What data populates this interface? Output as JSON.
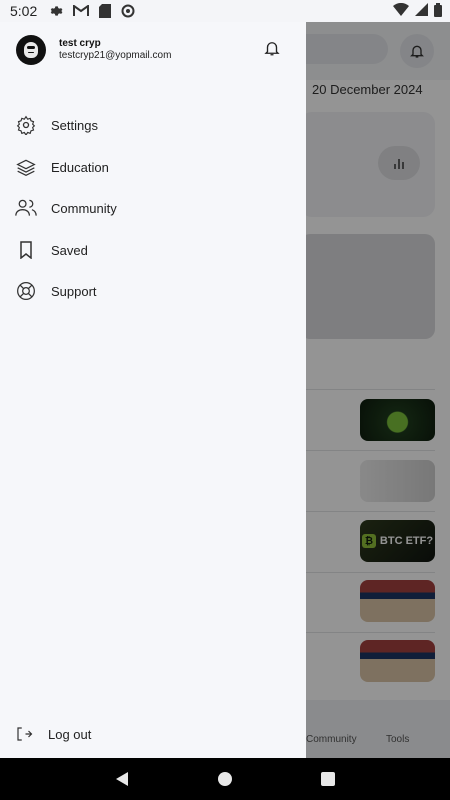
{
  "status_bar": {
    "time": "5:02"
  },
  "drawer": {
    "user": {
      "name": "test cryp",
      "email": "testcryp21@yopmail.com"
    },
    "menu": [
      {
        "label": "Settings",
        "icon": "settings-icon"
      },
      {
        "label": "Education",
        "icon": "layers-icon"
      },
      {
        "label": "Community",
        "icon": "users-icon"
      },
      {
        "label": "Saved",
        "icon": "bookmark-icon"
      },
      {
        "label": "Support",
        "icon": "lifebuoy-icon"
      }
    ],
    "logout_label": "Log out"
  },
  "background": {
    "date": "20 December 2024",
    "thumb_btc_text": "BTC ETF?",
    "nav_labels": [
      "Community",
      "Tools"
    ]
  }
}
